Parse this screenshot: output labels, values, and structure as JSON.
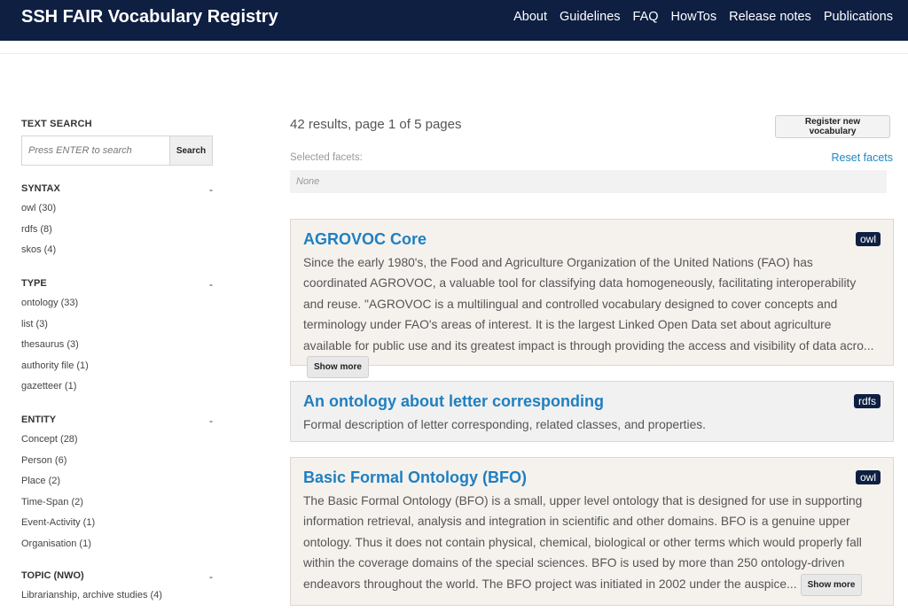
{
  "header": {
    "brand": "SSH FAIR Vocabulary Registry",
    "nav": [
      "About",
      "Guidelines",
      "FAQ",
      "HowTos",
      "Release notes",
      "Publications"
    ]
  },
  "sidebar": {
    "text_search_title": "TEXT SEARCH",
    "search_placeholder": "Press ENTER to search",
    "search_button": "Search",
    "toggle_symbol": "-",
    "facets": [
      {
        "title": "SYNTAX",
        "items": [
          "owl (30)",
          "rdfs (8)",
          "skos (4)"
        ]
      },
      {
        "title": "TYPE",
        "items": [
          "ontology (33)",
          "list (3)",
          "thesaurus (3)",
          "authority file (1)",
          "gazetteer (1)"
        ]
      },
      {
        "title": "ENTITY",
        "items": [
          "Concept (28)",
          "Person (6)",
          "Place (2)",
          "Time-Span (2)",
          "Event-Activity (1)",
          "Organisation (1)"
        ]
      },
      {
        "title": "TOPIC (NWO)",
        "items": [
          "Librarianship, archive studies (4)"
        ]
      }
    ]
  },
  "main": {
    "results_summary": "42 results, page 1 of 5 pages",
    "register_button": "Register new vocabulary",
    "selected_facets_label": "Selected facets:",
    "reset_facets": "Reset facets",
    "selected_facets_value": "None",
    "show_more_label": "Show more",
    "results": [
      {
        "title": "AGROVOC Core",
        "badge": "owl",
        "description": "Since the early 1980's, the Food and Agriculture Organization of the United Nations (FAO) has coordinated AGROVOC, a valuable tool for classifying data homogeneously, facilitating interoperability and reuse. \"AGROVOC is a multilingual and controlled vocabulary designed to cover concepts and terminology under FAO's areas of interest. It is the largest Linked Open Data set about agriculture available for public use and its greatest impact is through providing the access and visibility of data acro..."
      },
      {
        "title": "An ontology about letter corresponding",
        "badge": "rdfs",
        "description": "Formal description of letter corresponding, related classes, and properties."
      },
      {
        "title": "Basic Formal Ontology (BFO)",
        "badge": "owl",
        "description": "The Basic Formal Ontology (BFO) is a small, upper level ontology that is designed for use in supporting information retrieval, analysis and integration in scientific and other domains. BFO is a genuine upper ontology. Thus it does not contain physical, chemical, biological or other terms which would properly fall within the coverage domains of the special sciences. BFO is used by more than 250 ontology-driven endeavors throughout the world. The BFO project was initiated in 2002 under the auspice..."
      }
    ]
  }
}
